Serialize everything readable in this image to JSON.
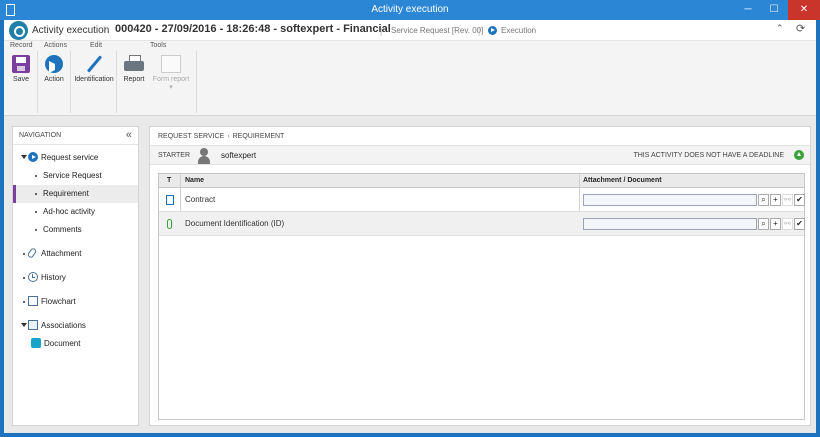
{
  "window": {
    "title": "Activity execution",
    "minimize_glyph": "─",
    "maximize_glyph": "☐",
    "close_glyph": "✕"
  },
  "header": {
    "module": "Activity execution",
    "chevron": "›",
    "record": "000420 - 27/09/2016 - 18:26:48 - softexpert - Financial",
    "separator": "|",
    "process_type": "Service Request [Rev. 00]",
    "status": "Execution",
    "collapse_glyph": "⌃",
    "refresh_glyph": "⟳"
  },
  "ribbon": {
    "groups": [
      "Record",
      "Actions",
      "Edit",
      "Tools"
    ],
    "tools": {
      "save": "Save",
      "action": "Action",
      "identification": "Identification",
      "report": "Report",
      "form_report": "Form report",
      "form_report_arrow": "▾"
    }
  },
  "navigation": {
    "title": "NAVIGATION",
    "collapse_glyph": "«",
    "items": {
      "request_service": "Request service",
      "service_request": "Service Request",
      "requirement": "Requirement",
      "adhoc": "Ad-hoc activity",
      "comments": "Comments",
      "attachment": "Attachment",
      "history": "History",
      "flowchart": "Flowchart",
      "associations": "Associations",
      "document": "Document"
    },
    "selected": "Requirement"
  },
  "main": {
    "breadcrumb": [
      "REQUEST SERVICE",
      "REQUIREMENT"
    ],
    "breadcrumb_sep": "›",
    "starter_label": "STARTER",
    "starter_name": "softexpert",
    "deadline_text": "THIS ACTIVITY DOES NOT HAVE A DEADLINE",
    "grid": {
      "columns": [
        "T",
        "Name",
        "Attachment / Document"
      ],
      "rows": [
        {
          "type_icon": "document-icon",
          "name": "Contract",
          "value": ""
        },
        {
          "type_icon": "attachment-icon",
          "name": "Document Identification (ID)",
          "value": ""
        }
      ],
      "row_buttons": {
        "search": "⌕",
        "add": "+",
        "view": "⚯",
        "clear": "✔"
      }
    }
  },
  "colors": {
    "window_blue": "#2b86d6",
    "accent_purple": "#7b3f9e",
    "close_red": "#c9352b",
    "success_green": "#3aa13a"
  }
}
